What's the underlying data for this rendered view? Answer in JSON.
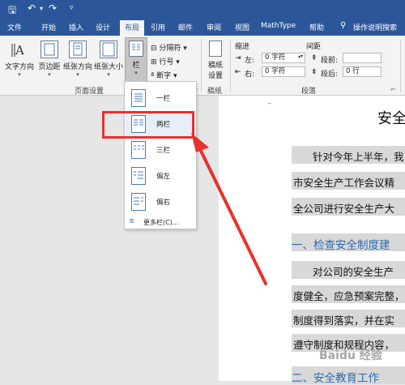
{
  "quick_access": {
    "save_icon": "save-icon",
    "undo_icon": "undo-icon",
    "undo_caret": "▾",
    "redo_icon": "redo-icon",
    "customize_icon": "customize-qat-icon"
  },
  "tabs": [
    "文件",
    "开始",
    "插入",
    "设计",
    "布局",
    "引用",
    "邮件",
    "审阅",
    "视图",
    "MathType",
    "帮助"
  ],
  "active_tab": "布局",
  "tell_me": {
    "icon": "lightbulb-icon",
    "label": "操作说明搜索"
  },
  "ribbon": {
    "page_setup": {
      "label": "页面设置",
      "buttons": [
        "文字方向",
        "页边距",
        "纸张方向",
        "纸张大小",
        "栏"
      ],
      "small_items": [
        "分隔符",
        "行号",
        "断字"
      ],
      "launcher": "⌐"
    },
    "draft": {
      "button": [
        "稿纸",
        "设置"
      ],
      "label": "稿纸"
    },
    "paragraph": {
      "label": "段落",
      "indent_label": "缩进",
      "spacing_label": "间距",
      "left_label": "左:",
      "left_value": "0 字符",
      "right_label": "右:",
      "right_value": "0 字符",
      "before_label": "段前:",
      "before_value": "",
      "after_label": "段后:",
      "after_value": "0 行"
    }
  },
  "columns_menu": {
    "items": [
      "一栏",
      "两栏",
      "三栏",
      "偏左",
      "偏右"
    ],
    "more": "更多栏(C)...",
    "highlighted": "两栏"
  },
  "document": {
    "title": "安全",
    "lines": [
      "针对今年上半年，我",
      "市安全生产工作会议精",
      "全公司进行安全生产大"
    ],
    "heading1": "一、检查安全制度建",
    "lines2": [
      "对公司的安全生产",
      "度健全，应急预案完整，",
      "制度得到落实，并在实",
      "遵守制度和规程内容，"
    ],
    "heading2": "二、安全教育工作"
  },
  "watermark": "Baidu 经验",
  "colors": {
    "brand_blue": "#2b579a",
    "highlight_red": "#e8312d",
    "heading_blue": "#2e6bb0"
  }
}
